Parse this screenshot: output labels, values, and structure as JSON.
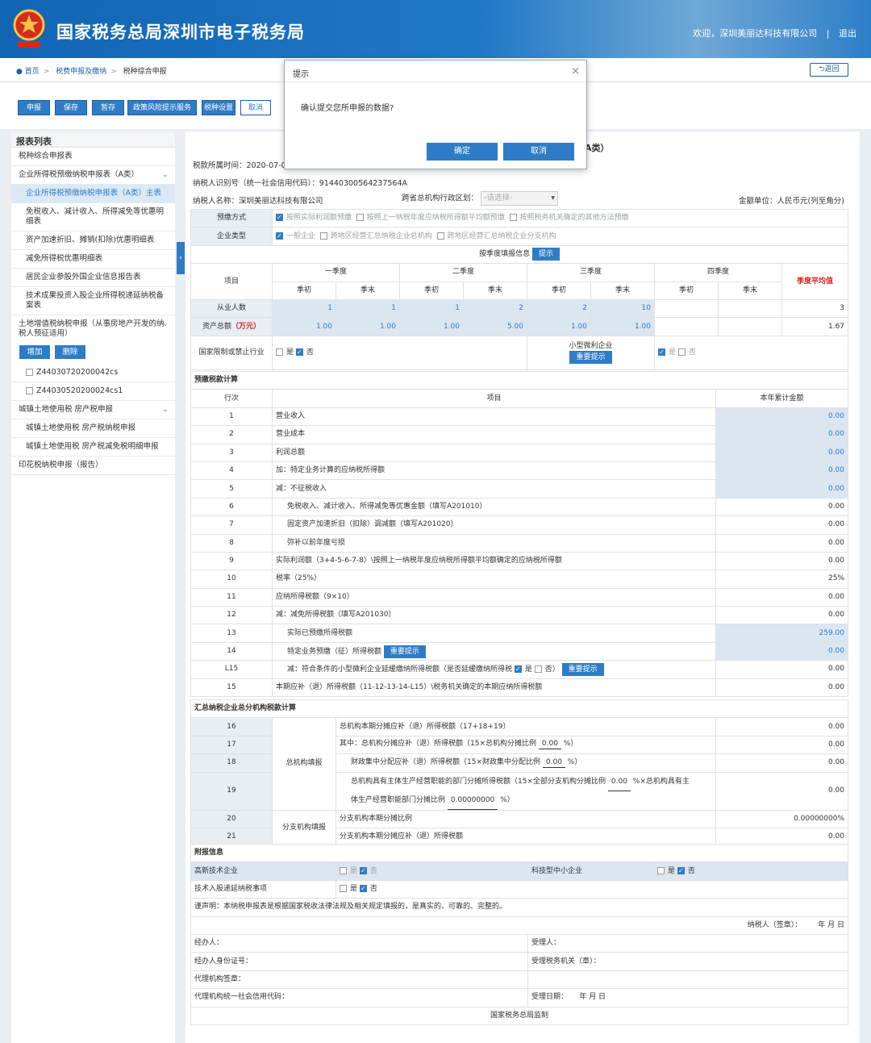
{
  "header": {
    "title": "国家税务总局深圳市电子税务局",
    "welcome": "欢迎，深圳美丽达科技有限公司",
    "divider": "|",
    "logout": "退出"
  },
  "breadcrumb": {
    "home": "首页",
    "level1": "税费申报及缴纳",
    "level2": "税种综合申报",
    "back": "返回"
  },
  "toolbar": {
    "declare": "申报",
    "save": "保存",
    "temp_save": "暂存",
    "policy": "政策风险提示服务",
    "settings": "税种设置",
    "cancel": "取消"
  },
  "dialog": {
    "title": "提示",
    "message": "确认提交您所申报的数据?",
    "ok": "确定",
    "cancel": "取消"
  },
  "sidebar": {
    "title": "报表列表",
    "items": [
      "税种综合申报表",
      "企业所得税预缴纳税申报表（A类）",
      "企业所得税预缴纳税申报表（A类）主表",
      "免税收入、减计收入、所得减免等优惠明细表",
      "资产加速折旧、摊销(扣除)优惠明细表",
      "减免所得税优惠明细表",
      "居民企业参股外国企业信息报告表",
      "技术成果投资入股企业所得税递延纳税备案表",
      "土地增值税纳税申报（从事房地产开发的纳税人预征适用）",
      "Z44030720200042cs",
      "Z44030520200024cs1",
      "城镇土地使用税 房产税申报",
      "城镇土地使用税 房产税纳税申报",
      "城镇土地使用税 房产税减免税明细申报",
      "印花税纳税申报（报告）"
    ],
    "add": "增加",
    "delete": "删除"
  },
  "form": {
    "title_suffix": "A类）",
    "period": "税款所属时间：2020-07-0",
    "taxpayer_id": "纳税人识别号（统一社会信用代码）：91440300564237564A",
    "taxpayer_name": "纳税人名称：深圳美丽达科技有限公司",
    "region_label": "跨省总机构行政区划：",
    "region_placeholder": "-请选择-",
    "unit": "金额单位：人民币元(列至角分)",
    "prepay_label": "预缴方式",
    "prepay_opts": [
      "按照实际利润额预缴",
      "按照上一纳税年度应纳税所得额平均额预缴",
      "按照税务机关确定的其他方法预缴"
    ],
    "type_label": "企业类型",
    "type_opts": [
      "一般企业",
      "跨地区经营汇总纳税企业总机构",
      "跨地区经营汇总纳税企业分支机构"
    ],
    "quarter_info": "按季度填报信息",
    "hint": "提示",
    "item": "项目",
    "q1": "一季度",
    "q2": "二季度",
    "q3": "三季度",
    "q4": "四季度",
    "qavg": "季度平均值",
    "qstart": "季初",
    "qend": "季末",
    "employees_label": "从业人数",
    "employees": [
      "1",
      "1",
      "1",
      "2",
      "2",
      "10",
      "",
      "",
      "3"
    ],
    "assets_label": "资产总额",
    "assets_unit": "（万元）",
    "assets": [
      "1.00",
      "1.00",
      "1.00",
      "5.00",
      "1.00",
      "1.00",
      "",
      "",
      "1.67"
    ],
    "restricted_label": "国家限制或禁止行业",
    "yes": "是",
    "no": "否",
    "small_label": "小型微利企业",
    "important_hint": "重要提示",
    "calc_section": "预缴税款计算",
    "row_no": "行次",
    "ytd": "本年累计金额",
    "rows": [
      {
        "n": "1",
        "t": "营业收入",
        "v": "0.00"
      },
      {
        "n": "2",
        "t": "营业成本",
        "v": "0.00"
      },
      {
        "n": "3",
        "t": "利润总额",
        "v": "0.00"
      },
      {
        "n": "4",
        "t": "加：特定业务计算的应纳税所得额",
        "v": "0.00"
      },
      {
        "n": "5",
        "t": "减：不征税收入",
        "v": "0.00"
      },
      {
        "n": "6",
        "t": "免税收入、减计收入、所得减免等优惠金额（填写A201010）",
        "v": "0.00"
      },
      {
        "n": "7",
        "t": "固定资产加速折旧（扣除）调减额（填写A201020）",
        "v": "0.00"
      },
      {
        "n": "8",
        "t": "弥补以前年度亏损",
        "v": "0.00"
      },
      {
        "n": "9",
        "t": "实际利润额（3+4-5-6-7-8）\\按照上一纳税年度应纳税所得额平均额确定的应纳税所得额",
        "v": "0.00"
      },
      {
        "n": "10",
        "t": "税率（25%）",
        "v": "25%"
      },
      {
        "n": "11",
        "t": "应纳所得税额（9×10）",
        "v": "0.00"
      },
      {
        "n": "12",
        "t": "减：减免所得税额（填写A201030）",
        "v": "0.00"
      },
      {
        "n": "13",
        "t": "实际已预缴所得税额",
        "v": "259.00"
      },
      {
        "n": "14",
        "t": "特定业务预缴（征）所得税额",
        "v": "0.00"
      },
      {
        "n": "L15",
        "t": "减：符合条件的小型微利企业延缓缴纳所得税额（是否延缓缴纳所得税",
        "v": "0.00"
      },
      {
        "n": "15",
        "t": "本期应补（退）所得税额（11-12-13-14-L15）\\税务机关确定的本期应纳所得税额",
        "v": "0.00"
      }
    ],
    "summary_section": "汇总纳税企业总分机构税款计算",
    "hq_label": "总机构填报",
    "branch_label": "分支机构填报",
    "r16": "总机构本期分摊应补（退）所得税额（17+18+19）",
    "v16": "0.00",
    "r17a": "其中：总机构分摊应补（退）所得税额（15×总机构分摊比例",
    "r17b": "0.00",
    "v17": "0.00",
    "r18a": "财政集中分配应补（退）所得税额（15×财政集中分配比例",
    "r18b": "0.00",
    "v18": "0.00",
    "r19a": "总机构具有主体生产经营职能的部门分摊所得税额（15×全部分支机构分摊比例",
    "r19b": "0.00",
    "r19c": "%×总机构具有主",
    "r19d": "体生产经营职能部门分摊比例",
    "r19e": "0.00000000",
    "v19": "0.00",
    "r20": "分支机构本期分摊比例",
    "v20": "0.00000000%",
    "r21": "分支机构本期分摊应补（退）所得税额",
    "v21": "0.00",
    "attach_section": "附报信息",
    "hitech": "高新技术企业",
    "scitech": "科技型中小企业",
    "techinvest": "技术入股递延纳税事项",
    "declaration": "谨声明：本纳税申报表是根据国家税收法律法规及相关规定填报的，是真实的、可靠的、完整的。",
    "sign": "纳税人（签章）：",
    "ymd": "年    月    日",
    "handler": "经办人：",
    "handler_id": "经办人身份证号：",
    "agent_sign": "代理机构签章：",
    "agent_code": "代理机构统一社会信用代码：",
    "receiver": "受理人：",
    "receiver_office": "受理税务机关（章）：",
    "receive_date": "受理日期：",
    "footer": "国家税务总局监制",
    "pct": "%）"
  },
  "colors": {
    "accent": "#2f7cc6",
    "red": "#d31f1f",
    "header": "#1265b3"
  }
}
